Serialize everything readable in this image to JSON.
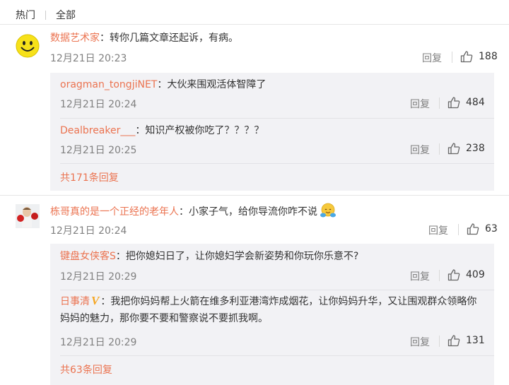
{
  "tabs": {
    "hot": "热门",
    "all": "全部"
  },
  "comments": [
    {
      "user": "数据艺术家",
      "text": "：转你几篇文章还起诉，有病。",
      "time": "12月21日 20:23",
      "reply": "回复",
      "likes": "188",
      "avatar": "smiley-avatar",
      "replies": [
        {
          "user": "oragman_tongjiNET",
          "text": "：大伙来围观活体智障了",
          "time": "12月21日 20:24",
          "reply": "回复",
          "likes": "484"
        },
        {
          "user": "Dealbreaker___",
          "text": "：知识产权被你吃了？？？？",
          "time": "12月21日 20:25",
          "reply": "回复",
          "likes": "238"
        }
      ],
      "more": "共171条回复"
    },
    {
      "user": "栋哥真的是一个正经的老年人",
      "text": "：小家子气，给你导流你咋不说",
      "time": "12月21日 20:24",
      "reply": "回复",
      "likes": "63",
      "avatar": "boxer-avatar",
      "replies": [
        {
          "user": "键盘女侠客S",
          "text": "：把你媳妇日了，让你媳妇学会新姿势和你玩你乐意不?",
          "time": "12月21日 20:29",
          "reply": "回复",
          "likes": "409"
        },
        {
          "user": "日事清",
          "verified_badge": "V",
          "text": "：我把你妈妈帮上火箭在维多利亚港湾炸成烟花，让你妈妈升华，又让围观群众领略你妈妈的魅力，那你要不要和警察说不要抓我啊。",
          "time": "12月21日 20:29",
          "reply": "回复",
          "likes": "131"
        }
      ],
      "more": "共63条回复"
    }
  ],
  "colors": {
    "accent": "#eb7350",
    "muted": "#808080",
    "sub_bg": "#f2f2f5",
    "badge": "#f5a623"
  }
}
